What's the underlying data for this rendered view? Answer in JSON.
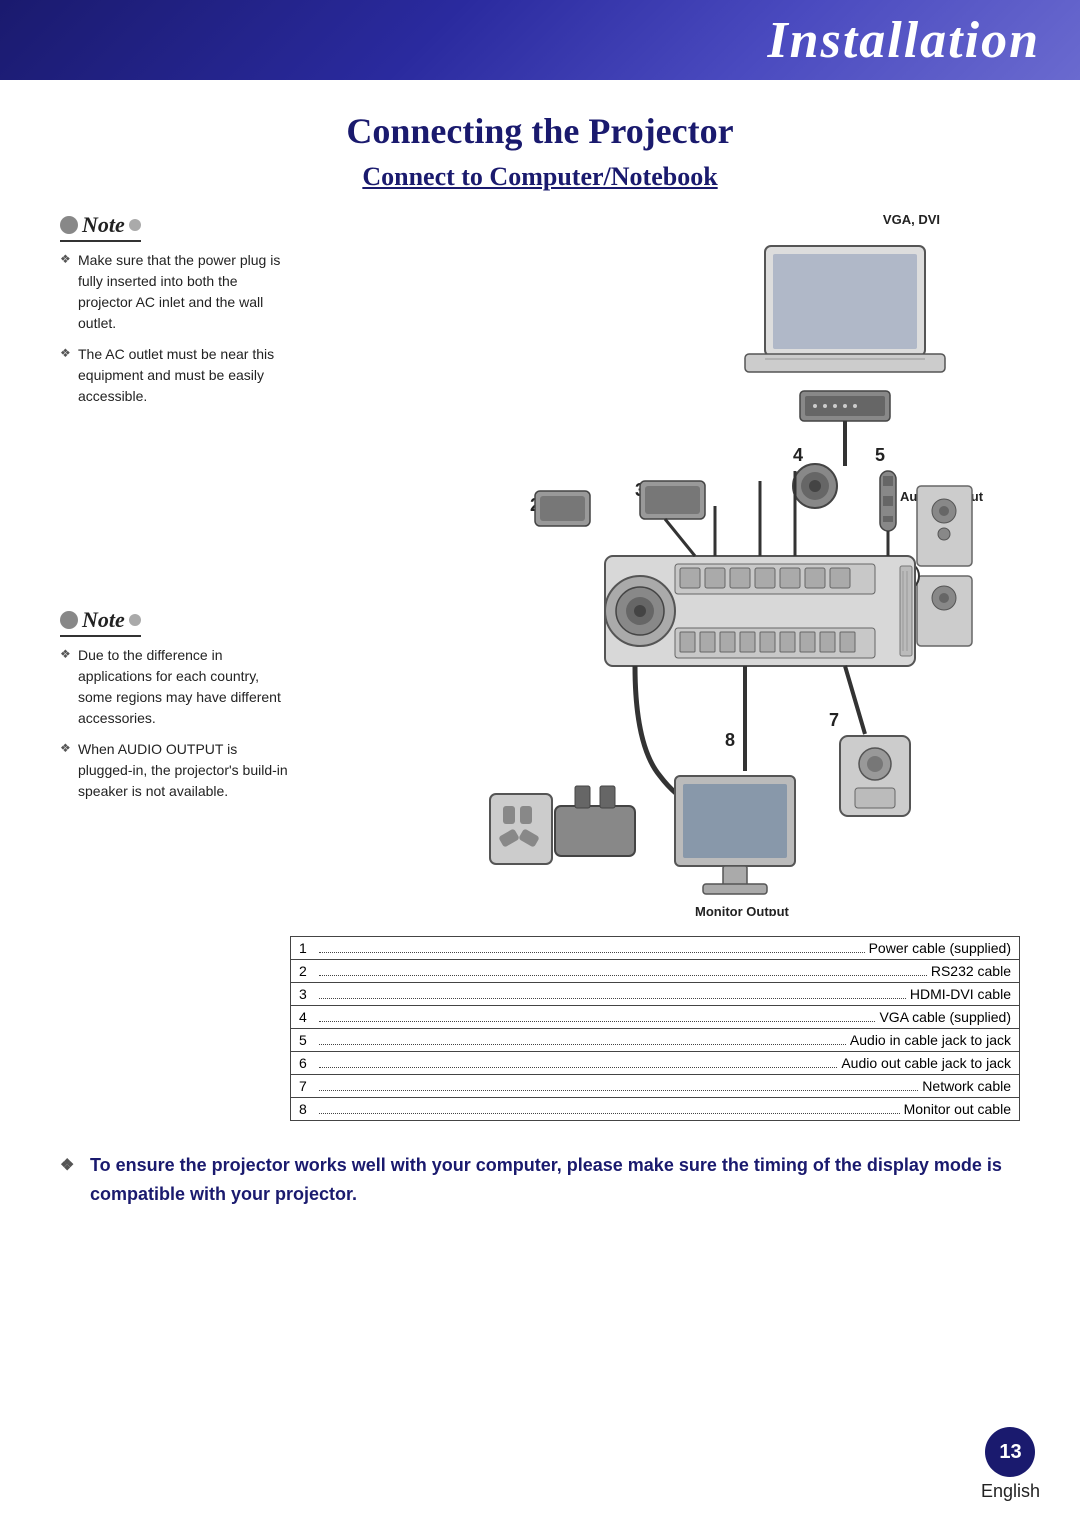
{
  "header": {
    "title": "Installation"
  },
  "page": {
    "section_title": "Connecting the Projector",
    "subsection_title": "Connect to Computer/Notebook",
    "vga_dvi_label": "VGA, DVI",
    "audio_output_label": "Audio Output",
    "monitor_output_label": "Monitor Output",
    "note1_label": "Note",
    "note1_items": [
      "Make sure that the power plug is fully inserted into both the projector AC inlet and the wall outlet.",
      "The AC outlet must be near this equipment and must be easily accessible."
    ],
    "note2_label": "Note",
    "note2_items": [
      "Due to the difference in applications for each country, some regions may have different accessories.",
      "When AUDIO OUTPUT is plugged-in, the projector's build-in speaker is not available."
    ],
    "cables": [
      {
        "num": "1",
        "name": "Power cable (supplied)"
      },
      {
        "num": "2",
        "name": "RS232 cable"
      },
      {
        "num": "3",
        "name": "HDMI-DVI cable"
      },
      {
        "num": "4",
        "name": "VGA cable (supplied)"
      },
      {
        "num": "5",
        "name": "Audio in cable jack to jack"
      },
      {
        "num": "6",
        "name": "Audio out cable jack to jack"
      },
      {
        "num": "7",
        "name": "Network cable"
      },
      {
        "num": "8",
        "name": "Monitor out cable"
      }
    ],
    "bottom_note": "To ensure the projector works well with your computer, please make sure the timing of the display mode is compatible with your projector.",
    "page_number": "13",
    "page_language": "English"
  }
}
